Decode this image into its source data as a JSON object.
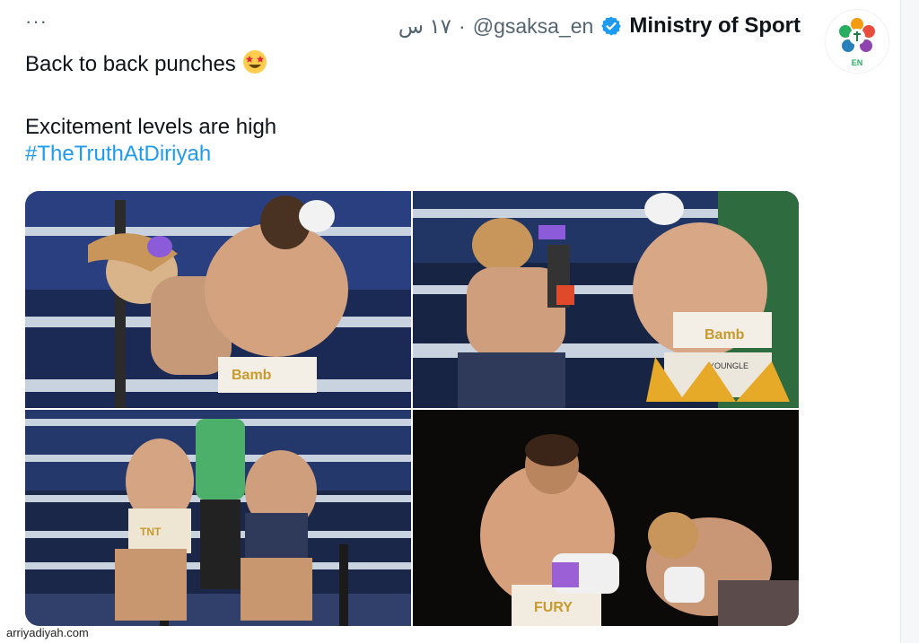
{
  "tweet": {
    "author_name": "Ministry of Sport",
    "handle": "@gsaksa_en",
    "separator": "·",
    "time": "١٧ س",
    "more_label": "···",
    "avatar_badge": "EN",
    "lines": {
      "line1": "Back to back punches",
      "line2": "Excitement levels are high",
      "hashtag": "#TheTruthAtDiriyah"
    },
    "emoji": "star-struck-emoji",
    "verified_color": "#1d9bf0",
    "hashtag_color": "#1d9bf0"
  },
  "media": {
    "photos": [
      {
        "icon": "boxing-photo-1"
      },
      {
        "icon": "boxing-photo-2"
      },
      {
        "icon": "boxing-photo-3"
      },
      {
        "icon": "boxing-photo-4"
      }
    ],
    "shorts_text": [
      "Bamb",
      "Bamb",
      "YOUNGLE",
      "TNT",
      "FURY"
    ]
  },
  "watermark": "arriyadiyah.com"
}
